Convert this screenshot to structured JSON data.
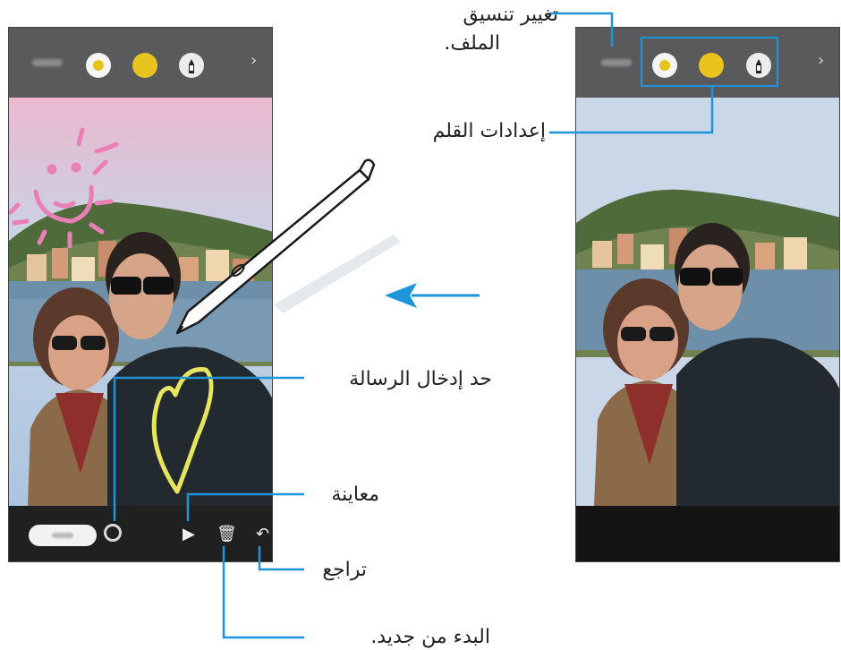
{
  "labels": {
    "change_file_format": "تغيير تنسيق\nالملف.",
    "change_file_format_line1": "تغيير تنسيق",
    "change_file_format_line2": "الملف.",
    "pen_settings": "إعدادات القلم",
    "message_input_limit": "حد إدخال الرسالة",
    "preview": "معاينة",
    "undo": "تراجع",
    "start_over": "البدء من جديد."
  },
  "icons": {
    "preview": "play-icon",
    "start_over": "trash-icon",
    "undo": "undo-icon",
    "more": "chevron-right-icon"
  },
  "colors": {
    "callout": "#1e95d8",
    "pen_yellow": "#e9c41f",
    "drawing_pink": "#ea7fb8",
    "drawing_yellow": "#e7e45d"
  }
}
